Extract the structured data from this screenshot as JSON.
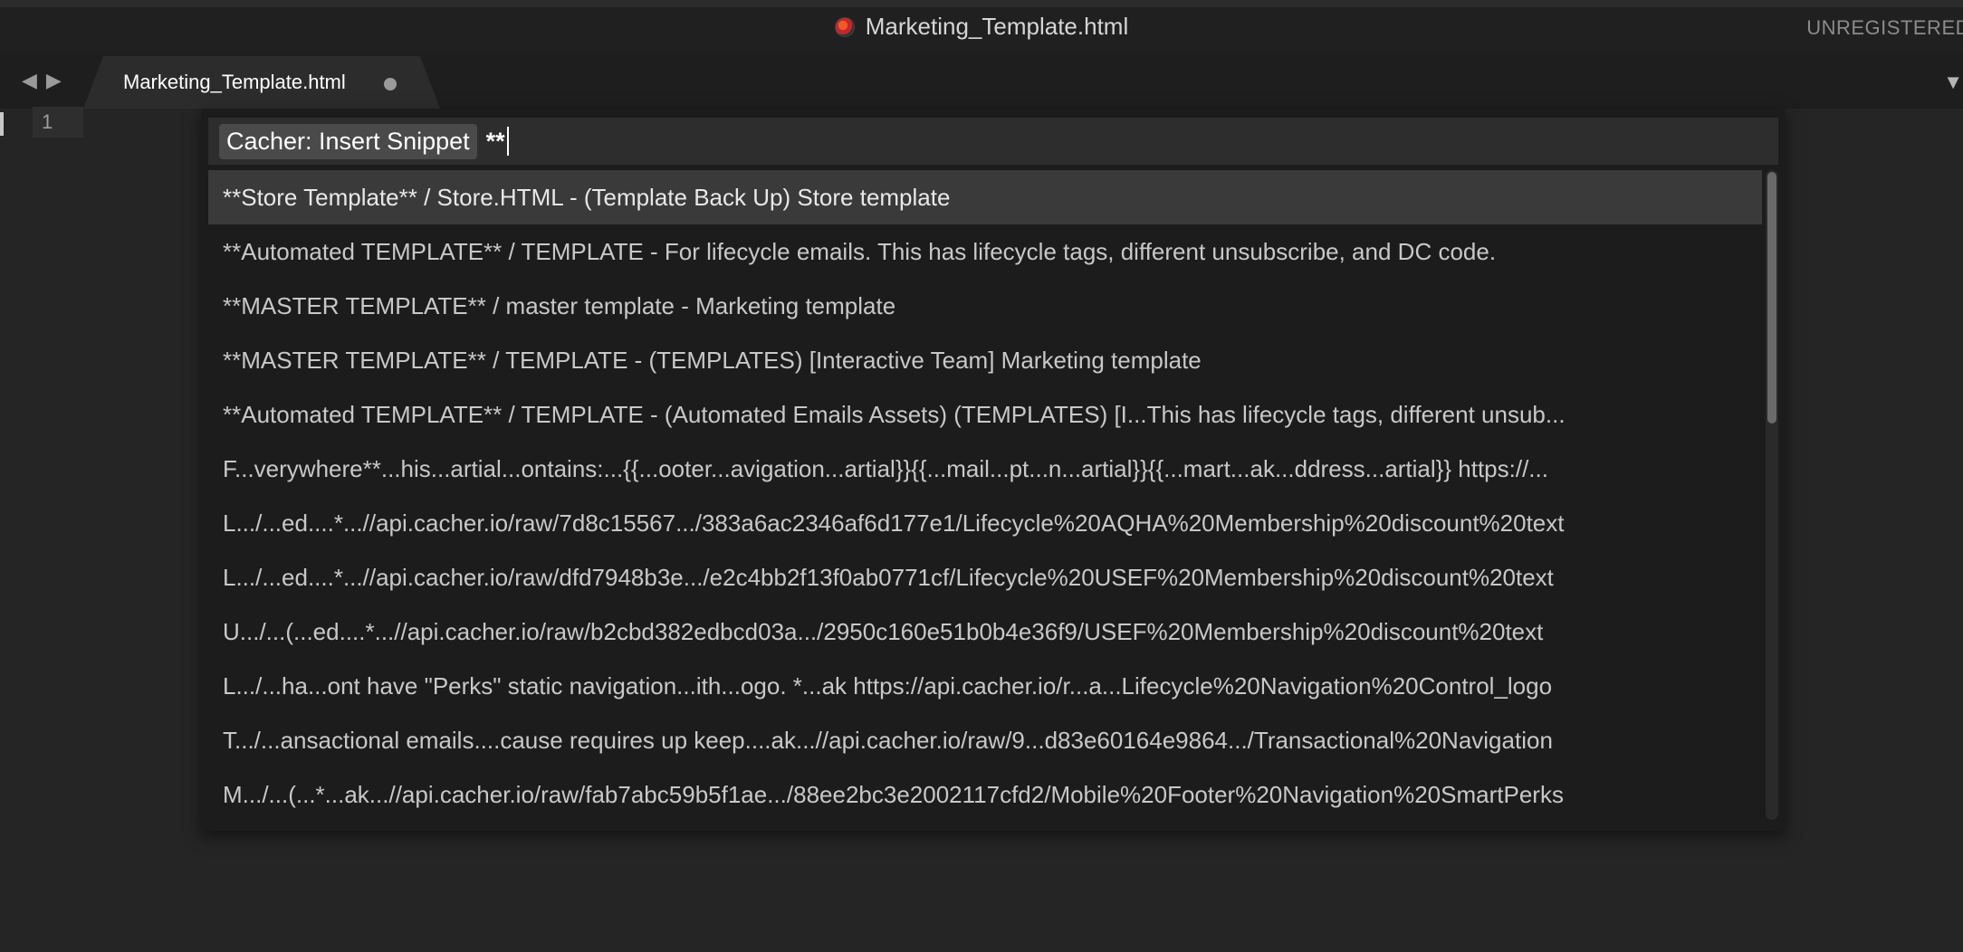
{
  "window": {
    "title": "Marketing_Template.html",
    "registration": "UNREGISTERED"
  },
  "tabbar": {
    "back_icon": "◀",
    "forward_icon": "▶",
    "active_tab": "Marketing_Template.html",
    "dropdown_icon": "▼"
  },
  "editor": {
    "line_number": "1"
  },
  "palette": {
    "prefix": "Cacher: Insert Snippet",
    "query": "**",
    "results": [
      "**Store Template** / Store.HTML - (Template Back Up) Store template",
      "**Automated TEMPLATE** / TEMPLATE - For lifecycle emails. This has lifecycle tags, different unsubscribe, and DC code.",
      "**MASTER TEMPLATE** / master template - Marketing template",
      "**MASTER TEMPLATE** / TEMPLATE - (TEMPLATES) [Interactive Team] Marketing template",
      "**Automated TEMPLATE** / TEMPLATE - (Automated Emails Assets) (TEMPLATES) [I...This has lifecycle tags, different unsub...",
      "F...verywhere**...his...artial...ontains:...{{...ooter...avigation...artial}}{{...mail...pt...n...artial}}{{...mart...ak...ddress...artial}} https://...",
      "L.../...ed....*...//api.cacher.io/raw/7d8c15567.../383a6ac2346af6d177e1/Lifecycle%20AQHA%20Membership%20discount%20text",
      "L.../...ed....*...//api.cacher.io/raw/dfd7948b3e.../e2c4bb2f13f0ab0771cf/Lifecycle%20USEF%20Membership%20discount%20text",
      "U.../...(...ed....*...//api.cacher.io/raw/b2cbd382edbcd03a.../2950c160e51b0b4e36f9/USEF%20Membership%20discount%20text",
      "L.../...ha...ont have \"Perks\" static navigation...ith...ogo. *...ak  https://api.cacher.io/r...a...Lifecycle%20Navigation%20Control_logo",
      "T.../...ansactional emails....cause requires up keep....ak...//api.cacher.io/raw/9...d83e60164e9864.../Transactional%20Navigation",
      "M.../...(...*...ak...//api.cacher.io/raw/fab7abc59b5f1ae.../88ee2bc3e2002117cfd2/Mobile%20Footer%20Navigation%20SmartPerks"
    ]
  }
}
